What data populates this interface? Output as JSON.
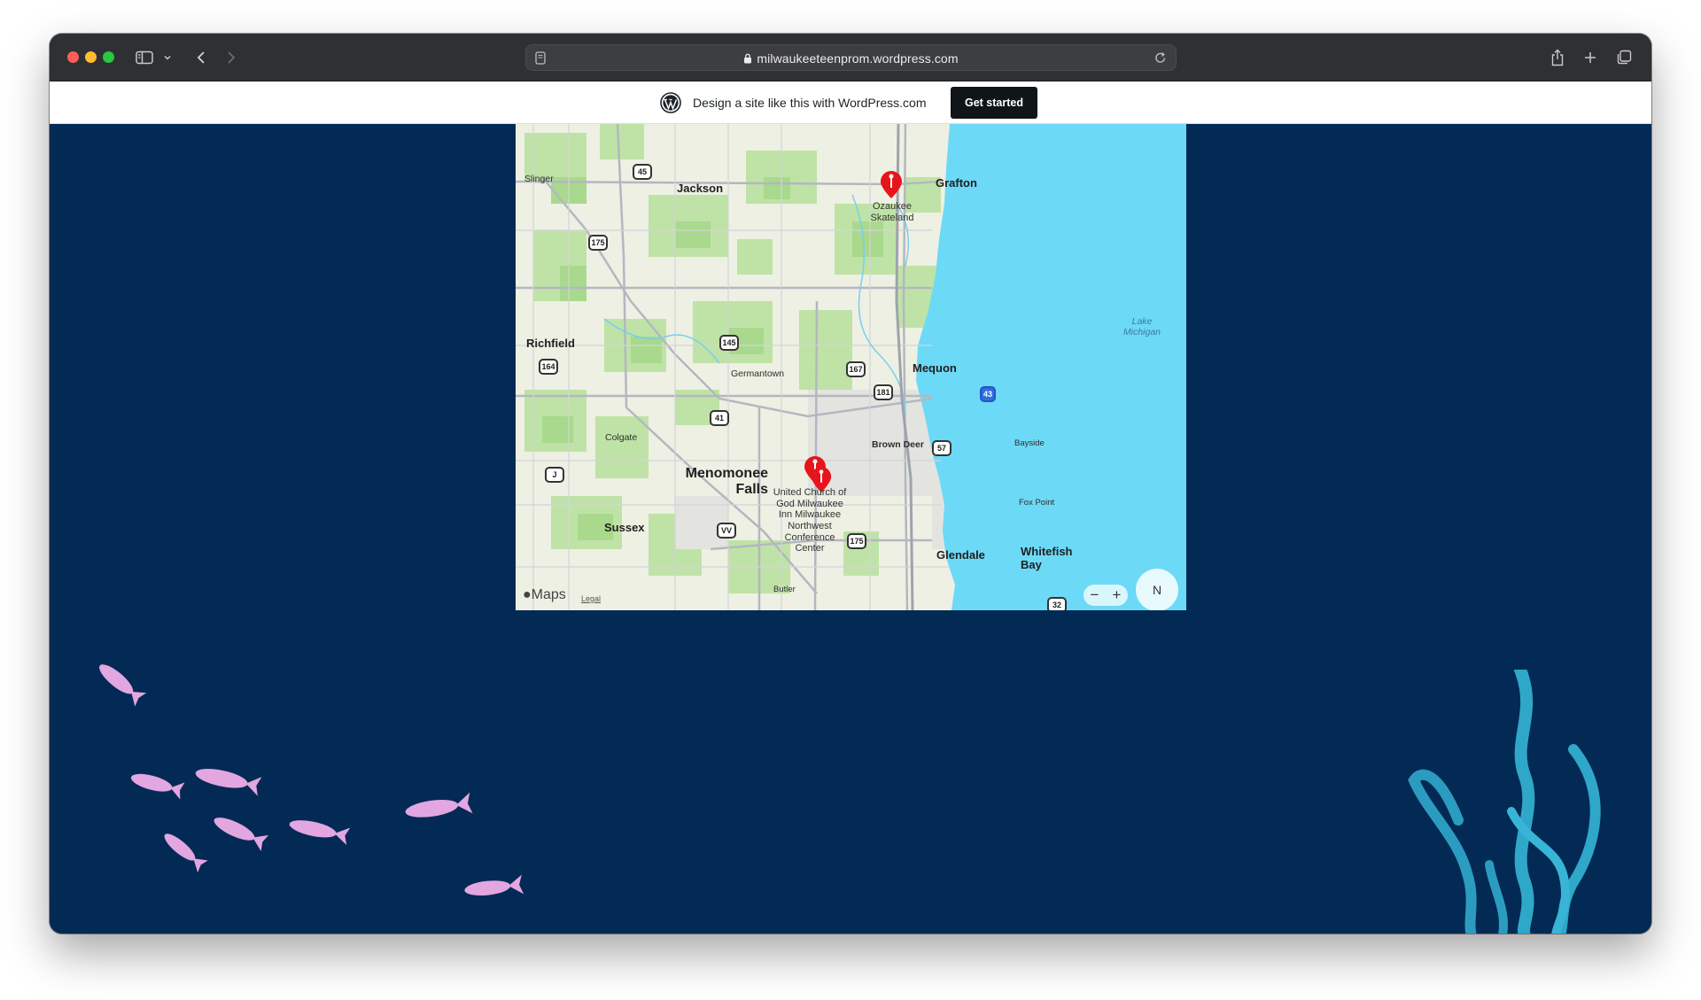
{
  "browser": {
    "url": "milwaukeeteenprom.wordpress.com",
    "share_icon": "share-icon",
    "new_tab_icon": "plus-icon",
    "tabs_icon": "tab-overview-icon"
  },
  "wp_banner": {
    "text": "Design a site like this with WordPress.com",
    "button": "Get started"
  },
  "map": {
    "cities": {
      "jackson": "Jackson",
      "grafton": "Grafton",
      "slinger": "Slinger",
      "richfield": "Richfield",
      "germantown": "Germantown",
      "mequon": "Mequon",
      "colgate": "Colgate",
      "brown_deer": "Brown Deer",
      "bayside": "Bayside",
      "menomonee_falls_1": "Menomonee",
      "menomonee_falls_2": "Falls",
      "fox_point": "Fox Point",
      "sussex": "Sussex",
      "glendale": "Glendale",
      "whitefish_bay_1": "Whitefish",
      "whitefish_bay_2": "Bay",
      "butler": "Butler"
    },
    "water": {
      "line1": "Lake",
      "line2": "Michigan"
    },
    "pois": {
      "ozaukee_1": "Ozaukee",
      "ozaukee_2": "Skateland",
      "church_1": "United Church of",
      "church_2": "God Milwaukee",
      "church_3": "Inn Milwaukee",
      "church_4": "Northwest",
      "church_5": "Conference",
      "church_6": "Center"
    },
    "shields": {
      "r45": "45",
      "r175a": "175",
      "r145": "145",
      "r164": "164",
      "r167": "167",
      "r181": "181",
      "r41": "41",
      "r43": "43",
      "r57": "57",
      "rJ": "J",
      "rVV": "VV",
      "r175b": "175",
      "r32": "32"
    },
    "maps_brand": "Maps",
    "legal": "Legal",
    "zoom_out": "−",
    "zoom_in": "+",
    "compass": "N"
  },
  "colors": {
    "page_bg": "#032a55",
    "lake": "#6cd9f7",
    "fish": "#e2a6e0",
    "kelp": "#2fa7c9",
    "pin": "#e8141b"
  }
}
